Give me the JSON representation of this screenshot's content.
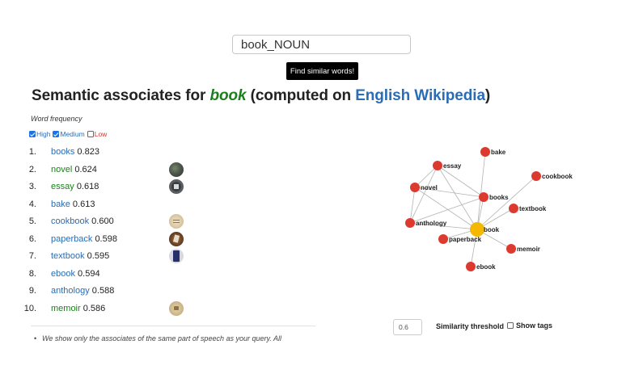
{
  "search": {
    "value": "book_NOUN"
  },
  "find_button_label": "Find similar words!",
  "title": {
    "prefix": "Semantic associates for ",
    "query": "book",
    "middle": " (computed on ",
    "corpus": "English Wikipedia",
    "suffix": ")"
  },
  "frequency": {
    "label": "Word frequency",
    "filters": [
      {
        "label": "High",
        "checked": true,
        "color": "#2a6db5"
      },
      {
        "label": "Medium",
        "checked": true,
        "color": "#2a6db5"
      },
      {
        "label": "Low",
        "checked": false,
        "color": "#d9342b"
      }
    ]
  },
  "results": [
    {
      "rank": "1.",
      "word": "books",
      "score": "0.823",
      "freq": "high",
      "thumb": null
    },
    {
      "rank": "2.",
      "word": "novel",
      "score": "0.624",
      "freq": "medium",
      "thumb": "novel-thumbnail"
    },
    {
      "rank": "3.",
      "word": "essay",
      "score": "0.618",
      "freq": "medium",
      "thumb": "essay-thumbnail"
    },
    {
      "rank": "4.",
      "word": "bake",
      "score": "0.613",
      "freq": "high",
      "thumb": null
    },
    {
      "rank": "5.",
      "word": "cookbook",
      "score": "0.600",
      "freq": "high",
      "thumb": "cookbook-thumbnail"
    },
    {
      "rank": "6.",
      "word": "paperback",
      "score": "0.598",
      "freq": "high",
      "thumb": "paperback-thumbnail"
    },
    {
      "rank": "7.",
      "word": "textbook",
      "score": "0.595",
      "freq": "high",
      "thumb": "textbook-thumbnail"
    },
    {
      "rank": "8.",
      "word": "ebook",
      "score": "0.594",
      "freq": "high",
      "thumb": null
    },
    {
      "rank": "9.",
      "word": "anthology",
      "score": "0.588",
      "freq": "high",
      "thumb": null
    },
    {
      "rank": "10.",
      "word": "memoir",
      "score": "0.586",
      "freq": "medium",
      "thumb": "memoir-thumbnail"
    }
  ],
  "note": "We show only the associates of the same part of speech as your query. All",
  "graph": {
    "center": "book",
    "nodes": [
      "bake",
      "essay",
      "cookbook",
      "novel",
      "books",
      "textbook",
      "anthology",
      "paperback",
      "memoir",
      "ebook"
    ],
    "center_color": "#f5b800",
    "node_color": "#dc3a2f"
  },
  "threshold": {
    "value": "0.6",
    "label": "Similarity threshold"
  },
  "show_tags": {
    "label": "Show tags",
    "checked": false
  },
  "colors": {
    "high": "#2a6db5",
    "medium": "#1a7f1a",
    "low": "#d9342b",
    "button": "#000000"
  }
}
